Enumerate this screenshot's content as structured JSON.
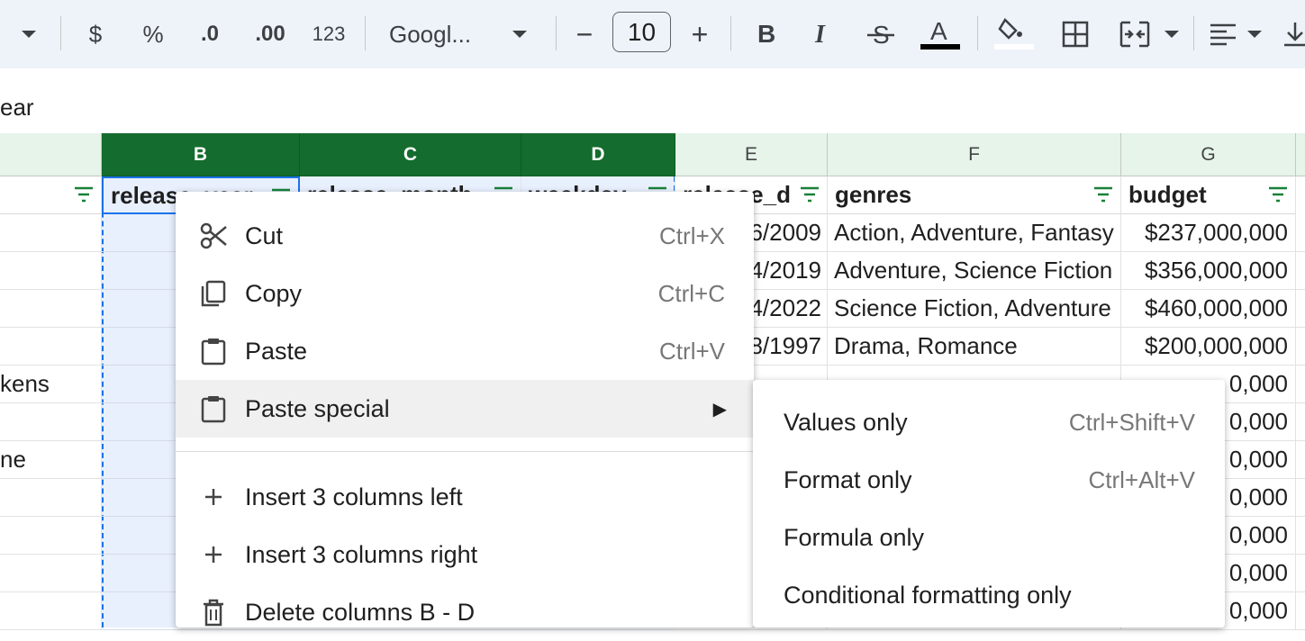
{
  "toolbar": {
    "currency": "$",
    "percent": "%",
    "decrease_decimal": ".0",
    "increase_decimal": ".00",
    "more_formats": "123",
    "font_family": "Googl...",
    "font_size": "10",
    "minus": "−",
    "plus": "+"
  },
  "formula_bar": {
    "content": "ear"
  },
  "columns": [
    {
      "letter": "B",
      "selected": true
    },
    {
      "letter": "C",
      "selected": true
    },
    {
      "letter": "D",
      "selected": true
    },
    {
      "letter": "E",
      "selected": false
    },
    {
      "letter": "F",
      "selected": false
    },
    {
      "letter": "G",
      "selected": false
    }
  ],
  "header_row": {
    "B": "release_year",
    "C": "release_month",
    "D": "weekday",
    "E": "release_d",
    "F": "genres",
    "G": "budget"
  },
  "col_a_cells": [
    "",
    "",
    "",
    "",
    "kens",
    "",
    "ne",
    "",
    "",
    "",
    "",
    ""
  ],
  "col_e_cells": [
    "6/2009",
    "4/2019",
    "4/2022",
    "8/1997",
    "",
    "",
    "",
    "",
    "",
    "",
    ""
  ],
  "col_f_cells": [
    "Action, Adventure, Fantasy",
    "Adventure, Science Fiction",
    "Science Fiction, Adventure",
    "Drama, Romance"
  ],
  "col_g_cells": [
    "$237,000,000",
    "$356,000,000",
    "$460,000,000",
    "$200,000,000",
    "0,000",
    "0,000",
    "0,000",
    "0,000",
    "0,000",
    "0,000",
    "0,000"
  ],
  "context_menu": {
    "items": [
      {
        "label": "Cut",
        "shortcut": "Ctrl+X",
        "icon": "scissors-icon"
      },
      {
        "label": "Copy",
        "shortcut": "Ctrl+C",
        "icon": "copy-icon"
      },
      {
        "label": "Paste",
        "shortcut": "Ctrl+V",
        "icon": "clipboard-icon"
      },
      {
        "label": "Paste special",
        "shortcut": "▶",
        "icon": "clipboard-icon"
      },
      {
        "label": "Insert 3 columns left",
        "shortcut": "",
        "icon": "plus-icon"
      },
      {
        "label": "Insert 3 columns right",
        "shortcut": "",
        "icon": "plus-icon"
      },
      {
        "label": "Delete columns B - D",
        "shortcut": "",
        "icon": "trash-icon"
      }
    ]
  },
  "paste_special_menu": {
    "items": [
      {
        "label": "Values only",
        "shortcut": "Ctrl+Shift+V"
      },
      {
        "label": "Format only",
        "shortcut": "Ctrl+Alt+V"
      },
      {
        "label": "Formula only",
        "shortcut": ""
      },
      {
        "label": "Conditional formatting only",
        "shortcut": ""
      }
    ]
  },
  "colors": {
    "selected_header": "#146c2e",
    "selection_fill": "#e8f0fe",
    "filter_icon": "#188038",
    "toolbar_bg": "#eef2f9"
  }
}
